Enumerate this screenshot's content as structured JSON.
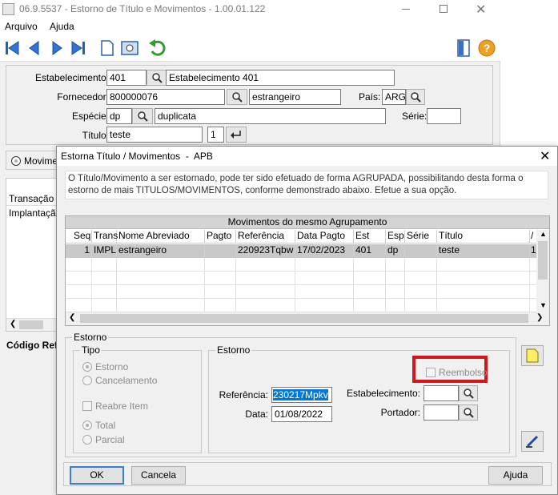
{
  "window": {
    "title": "06.9.5537 - Estorno de Título e Movimentos - 1.00.01.122"
  },
  "menu": {
    "arquivo": "Arquivo",
    "ajuda": "Ajuda"
  },
  "main": {
    "estab_label": "Estabelecimento:",
    "estab_code": "401",
    "estab_name": "Estabelecimento 401",
    "fornec_label": "Fornecedor:",
    "fornec_code": "800000076",
    "fornec_name": "estrangeiro",
    "pais_label": "País:",
    "pais_value": "ARG",
    "especie_label": "Espécie:",
    "especie_code": "dp",
    "especie_name": "duplicata",
    "serie_label": "Série:",
    "serie_value": "",
    "titulo_label": "Título:",
    "titulo_value": "teste",
    "parcela_value": "1",
    "radio_mov": "Movimen",
    "list_header": "Transação",
    "list_items": [
      "Implantação"
    ],
    "codigo_ref": "Código Refe"
  },
  "dialog": {
    "title": "Estorna Título / Movimentos  -  APB",
    "info": "O Título/Movimento a ser estornado, pode ter sido efetuado de forma AGRUPADA, possibilitando desta forma o estorno de mais TITULOS/MOVIMENTOS, conforme demonstrado abaixo. Efetue a sua opção.",
    "grid_title": "Movimentos do mesmo Agrupamento",
    "columns": [
      "Seq",
      "Trans",
      "Nome Abreviado",
      "Pagto",
      "Referência",
      "Data Pagto",
      "Est",
      "Esp",
      "Série",
      "Título",
      "/"
    ],
    "rows": [
      [
        "1",
        "IMPL",
        "estrangeiro",
        "",
        "220923Tqbw",
        "17/02/2023",
        "401",
        "dp",
        "",
        "teste",
        "1"
      ]
    ],
    "estorno_group": "Estorno",
    "tipo_group": "Tipo",
    "tipo_estorno": "Estorno",
    "tipo_cancel": "Cancelamento",
    "reabre": "Reabre Item",
    "total": "Total",
    "parcial": "Parcial",
    "estorno_inner": "Estorno",
    "reembolso": "Reembolso",
    "ref_label": "Referência:",
    "ref_value": "230217Mpkv",
    "data_label": "Data:",
    "data_value": "01/08/2022",
    "estab_label": "Estabelecimento:",
    "estab_value": "",
    "portador_label": "Portador:",
    "portador_value": "",
    "ok": "OK",
    "cancela": "Cancela",
    "ajuda": "Ajuda"
  }
}
